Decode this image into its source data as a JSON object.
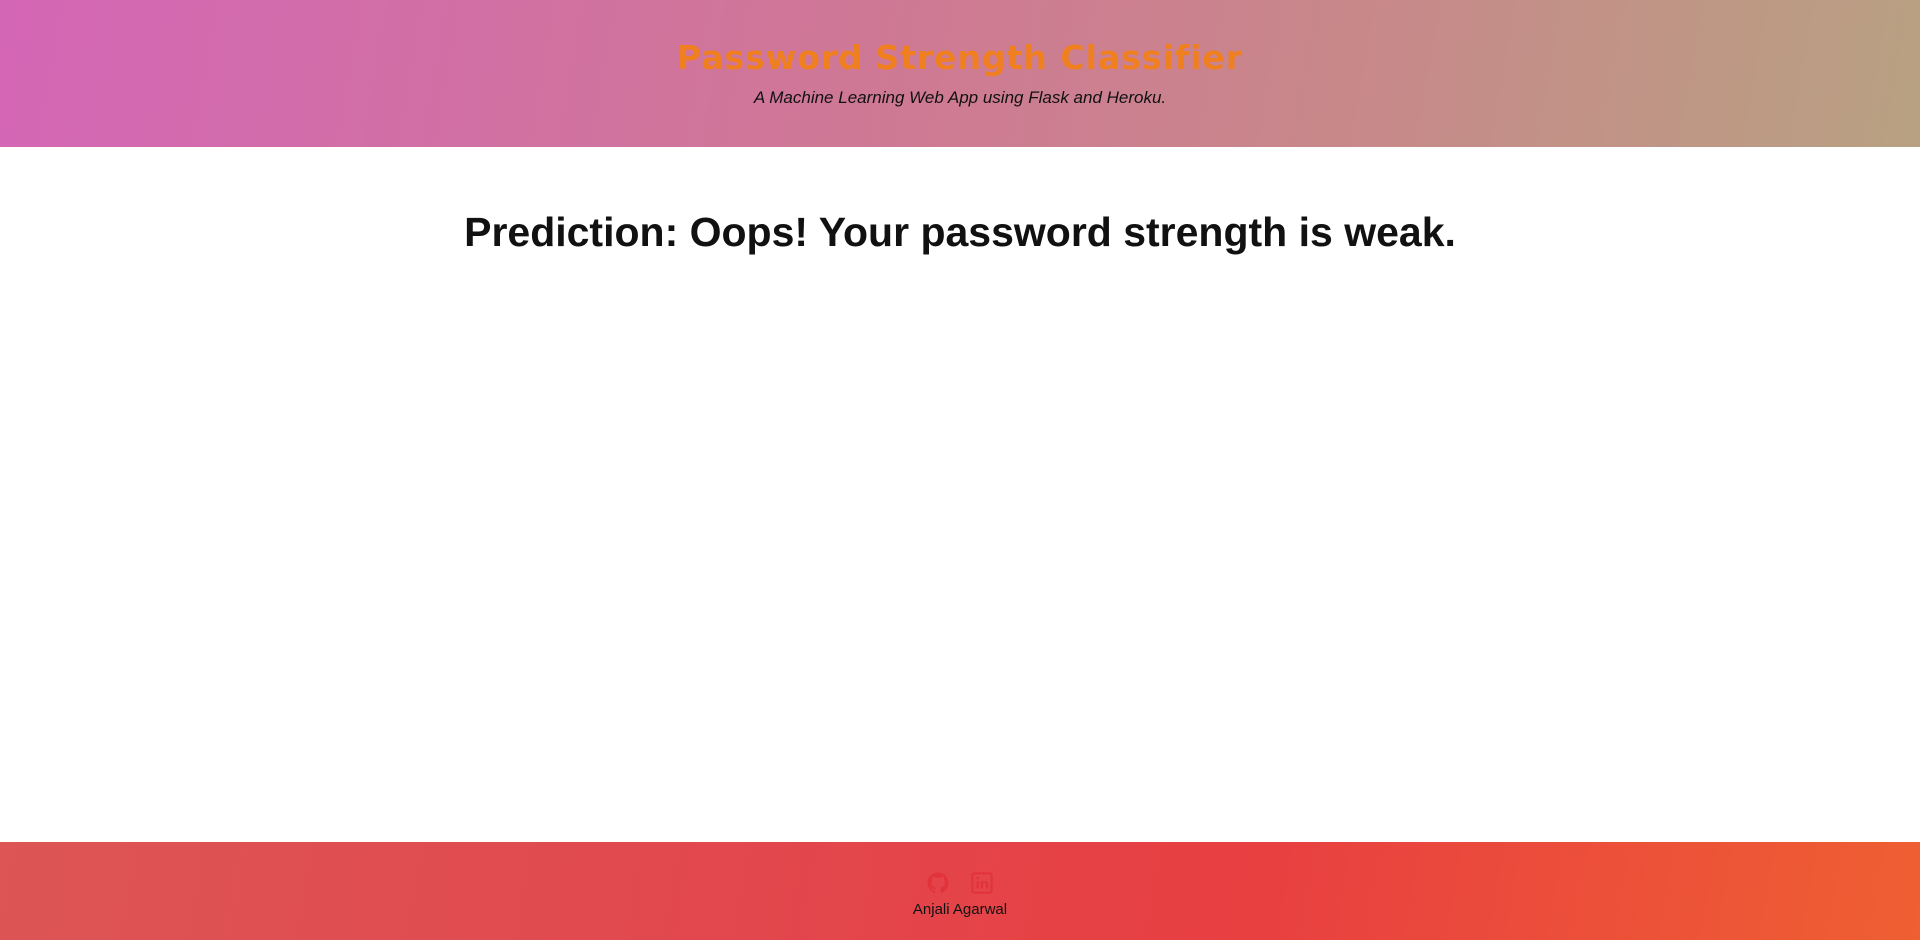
{
  "header": {
    "title": "Password Strength Classifier",
    "subtitle": "A Machine Learning Web App using Flask and Heroku."
  },
  "main": {
    "prediction": "Prediction: Oops! Your password strength is weak."
  },
  "footer": {
    "icons": [
      "github-icon",
      "linkedin-icon"
    ],
    "author": "Anjali Agarwal"
  },
  "colors": {
    "title": "#f07f1f",
    "icon": "#e2333b"
  }
}
